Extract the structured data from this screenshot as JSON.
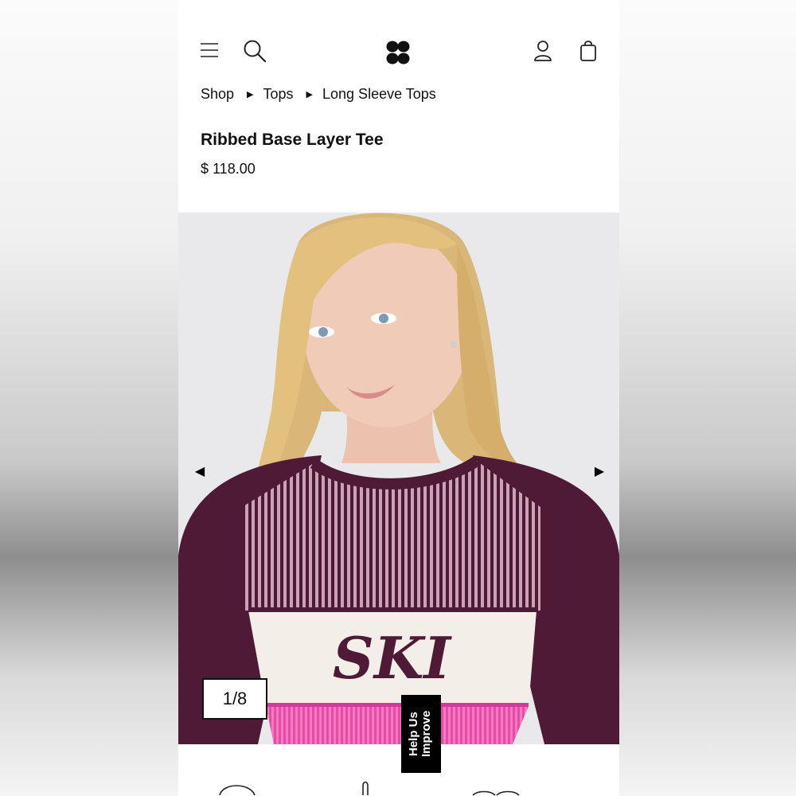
{
  "header": {
    "menu_icon": "hamburger-menu-icon",
    "search_icon": "search-icon",
    "logo_icon": "four-petal-logo",
    "account_icon": "user-icon",
    "bag_icon": "shopping-bag-icon"
  },
  "breadcrumb": {
    "items": [
      "Shop",
      "Tops",
      "Long Sleeve Tops"
    ],
    "separator_icon": "triangle-right-icon"
  },
  "product": {
    "title": "Ribbed Base Layer Tee",
    "price": "$ 118.00"
  },
  "gallery": {
    "counter": "1/8",
    "prev_icon": "triangle-left-icon",
    "next_icon": "triangle-right-icon",
    "garment_text": "SKI"
  },
  "feedback": {
    "label": "Help Us Improve"
  },
  "colors": {
    "plum": "#4e1a36",
    "pink": "#ea4aa6",
    "cream": "#f3efe8",
    "text": "#111111"
  }
}
